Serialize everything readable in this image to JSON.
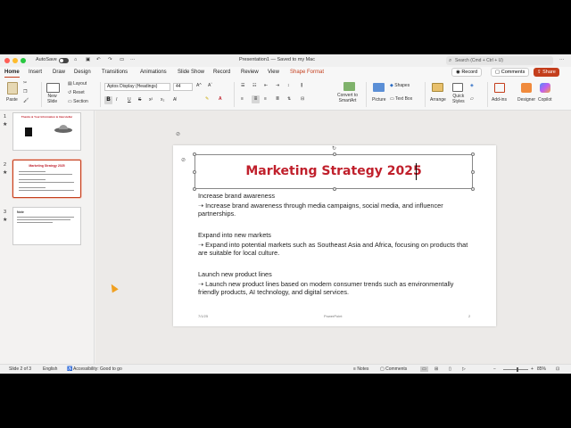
{
  "titlebar": {
    "autosave": "AutoSave",
    "doc_title": "Presentation1 — Saved to my Mac",
    "search_placeholder": "Search (Cmd + Ctrl + U)"
  },
  "tabs": [
    "Home",
    "Insert",
    "Draw",
    "Design",
    "Transitions",
    "Animations",
    "Slide Show",
    "Record",
    "Review",
    "View",
    "Shape Format"
  ],
  "top_buttons": {
    "record": "Record",
    "comments": "Comments",
    "share": "Share"
  },
  "ribbon": {
    "paste": "Paste",
    "new_slide": "New\nSlide",
    "layout": "Layout",
    "reset": "Reset",
    "section": "Section",
    "font_name": "Aptos Display (Headings)",
    "font_size": "44",
    "convert": "Convert to\nSmartArt",
    "picture": "Picture",
    "shapes": "Shapes",
    "text_box": "Text Box",
    "arrange": "Arrange",
    "quick_styles": "Quick\nStyles",
    "add_ins": "Add-ins",
    "designer": "Designer",
    "copilot": "Copilot"
  },
  "thumbnails": [
    {
      "num": "1",
      "title": "Thanks & Your Information & Interstellar"
    },
    {
      "num": "2",
      "title": "Marketing Strategy 2025"
    },
    {
      "num": "3",
      "title": "Note"
    }
  ],
  "slide": {
    "title": "Marketing Strategy 2025",
    "items": [
      {
        "heading": "Increase brand awareness",
        "detail": "➝ Increase brand awareness through media campaigns, social media, and influencer partnerships."
      },
      {
        "heading": "Expand into new markets",
        "detail": "➝ Expand into potential markets such as Southeast Asia and Africa, focusing on products that are suitable for local culture."
      },
      {
        "heading": "Launch new product lines",
        "detail": "➝ Launch new product lines based on modern consumer trends such as environmentally friendly products, AI technology, and digital services."
      }
    ],
    "footer_date": "7/1/25",
    "footer_center": "PowerPoint",
    "footer_page": "2"
  },
  "statusbar": {
    "slide_info": "Slide 2 of 3",
    "language": "English",
    "accessibility": "Accessibility: Good to go",
    "notes": "Notes",
    "comments": "Comments",
    "zoom": "85%"
  },
  "colors": {
    "accent": "#c43e1c",
    "title_red": "#c0202c"
  }
}
